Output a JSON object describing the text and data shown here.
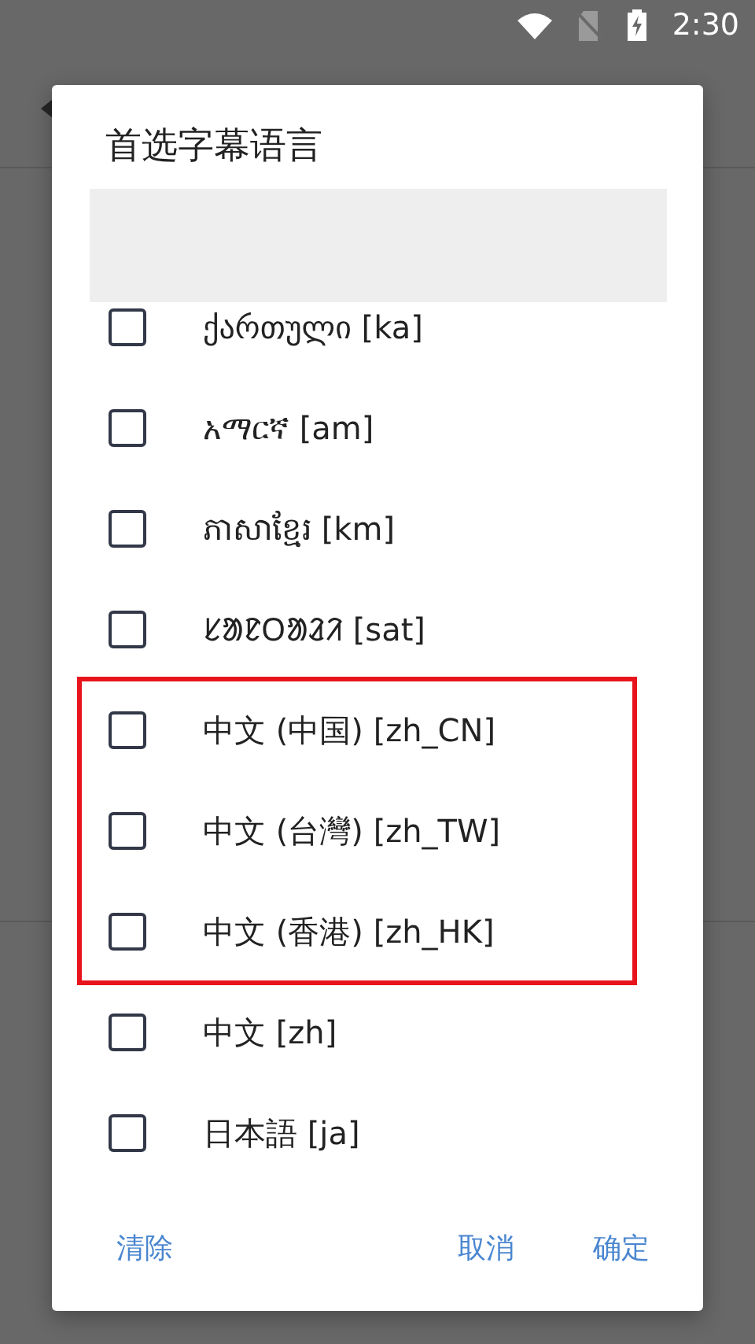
{
  "status_bar": {
    "time": "2:30"
  },
  "dialog": {
    "title": "首选字幕语言",
    "options": [
      {
        "label": "ქართული [ka]",
        "checked": false,
        "highlighted": false
      },
      {
        "label": "አማርኛ [am]",
        "checked": false,
        "highlighted": false
      },
      {
        "label": "ភាសាខ្មែរ [km]",
        "checked": false,
        "highlighted": false
      },
      {
        "label": "ᱥᱟᱱᱛᱟᱲᱤ [sat]",
        "checked": false,
        "highlighted": false
      },
      {
        "label": "中文 (中国) [zh_CN]",
        "checked": false,
        "highlighted": true
      },
      {
        "label": "中文 (台灣) [zh_TW]",
        "checked": false,
        "highlighted": true
      },
      {
        "label": "中文 (香港) [zh_HK]",
        "checked": false,
        "highlighted": true
      },
      {
        "label": "中文 [zh]",
        "checked": false,
        "highlighted": false
      },
      {
        "label": "日本語 [ja]",
        "checked": false,
        "highlighted": false
      }
    ],
    "buttons": {
      "left": [
        "清除"
      ],
      "right": [
        "取消",
        "确定"
      ]
    }
  }
}
